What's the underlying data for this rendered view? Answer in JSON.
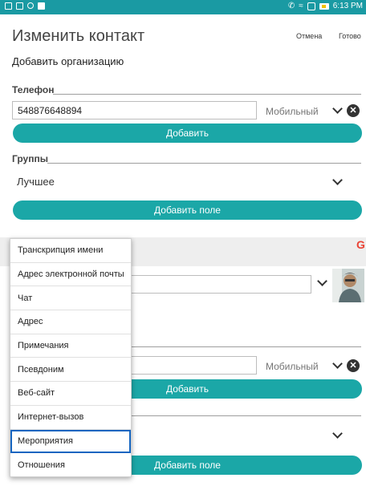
{
  "status_bar": {
    "time": "6:13 PM"
  },
  "header": {
    "title": "Изменить контакт",
    "cancel": "Отмена",
    "done": "Готово"
  },
  "add_org": "Добавить организацию",
  "phone": {
    "section_title": "Телефон",
    "value": "548876648894",
    "type": "Мобильный",
    "add_button": "Добавить"
  },
  "groups": {
    "section_title": "Группы",
    "value": "Лучшее",
    "add_field_button": "Добавить поле"
  },
  "lower": {
    "phone_type": "Мобильный",
    "add_button": "Добавить",
    "add_field_button": "Добавить поле"
  },
  "google_logo": "G",
  "menu": {
    "items": [
      "Транскрипция имени",
      "Адрес электронной почты",
      "Чат",
      "Адрес",
      "Примечания",
      "Псевдоним",
      "Веб-сайт",
      "Интернет-вызов",
      "Мероприятия",
      "Отношения"
    ],
    "selected_index": 8
  },
  "colors": {
    "accent": "#1ba7a7",
    "status_bar": "#1a9aa3",
    "selection": "#1565c0"
  }
}
